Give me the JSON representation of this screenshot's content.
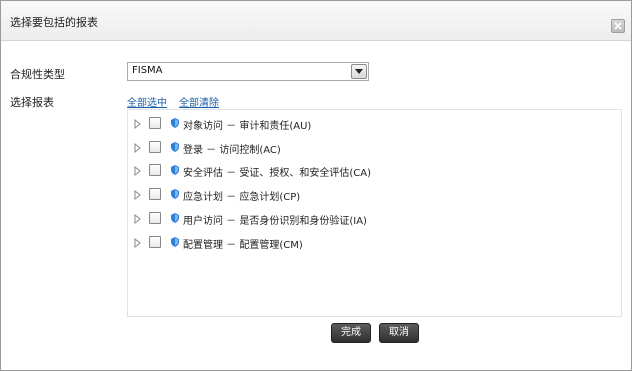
{
  "dialog": {
    "title": "选择要包括的报表",
    "close_icon": "close-icon"
  },
  "form": {
    "compliance_type_label": "合规性类型",
    "compliance_type_value": "FISMA",
    "select_reports_label": "选择报表",
    "select_all_link": "全部选中",
    "clear_all_link": "全部清除"
  },
  "tree": {
    "node_icon": "blue-shield-icon",
    "items": [
      {
        "label": "对象访问 － 审计和责任(AU)",
        "checked": false
      },
      {
        "label": "登录 － 访问控制(AC)",
        "checked": false
      },
      {
        "label": "安全评估 － 受证、授权、和安全评估(CA)",
        "checked": false
      },
      {
        "label": "应急计划 － 应急计划(CP)",
        "checked": false
      },
      {
        "label": "用户访问 － 是否身份识别和身份验证(IA)",
        "checked": false
      },
      {
        "label": "配置管理 － 配置管理(CM)",
        "checked": false
      }
    ]
  },
  "buttons": {
    "ok_label": "完成",
    "cancel_label": "取消"
  },
  "colors": {
    "link": "#1a5fa8",
    "button_bg": "#3a3a3a",
    "node_icon": "#2f7fd8"
  }
}
